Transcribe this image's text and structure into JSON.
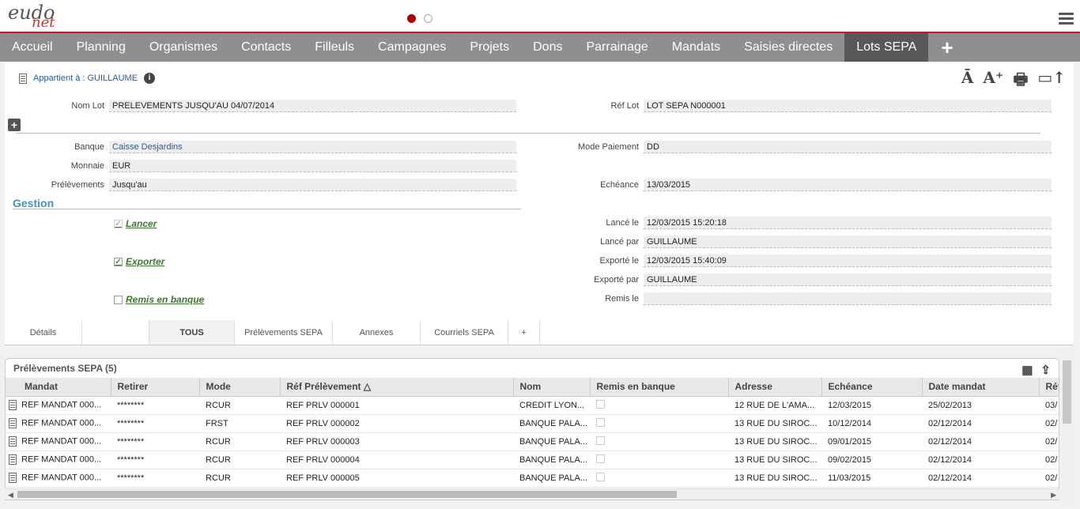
{
  "header": {
    "logo_main": "eudo",
    "logo_sub": "net"
  },
  "nav": {
    "items": [
      "Accueil",
      "Planning",
      "Organismes",
      "Contacts",
      "Filleuls",
      "Campagnes",
      "Projets",
      "Dons",
      "Parrainage",
      "Mandats",
      "Saisies directes",
      "Lots SEPA"
    ],
    "active": "Lots SEPA",
    "add": "+"
  },
  "record": {
    "owner": "Appartient à : GUILLAUME",
    "tools": [
      "Ā",
      "A⁺",
      "🖶",
      "▭↑"
    ],
    "nom_lot_label": "Nom Lot",
    "nom_lot": "PRELEVEMENTS JUSQU'AU 04/07/2014",
    "ref_lot_label": "Réf Lot",
    "ref_lot": "LOT SEPA N000001",
    "banque_label": "Banque",
    "banque": "Caisse Desjardins",
    "monnaie_label": "Monnaie",
    "monnaie": "EUR",
    "prelevements_label": "Prélèvements",
    "prelevements": "Jusqu'au",
    "mode_paiement_label": "Mode Paiement",
    "mode_paiement": "DD",
    "echeance_label": "Echéance",
    "echeance": "13/03/2015",
    "gestion": "Gestion",
    "lancer": "Lancer",
    "exporter": "Exporter",
    "remis": "Remis en banque",
    "lance_le_label": "Lancé le",
    "lance_le": "12/03/2015 15:20:18",
    "lance_par_label": "Lancé par",
    "lance_par": "GUILLAUME",
    "exporte_le_label": "Exporté le",
    "exporte_le": "12/03/2015 15:40:09",
    "exporte_par_label": "Exporté par",
    "exporte_par": "GUILLAUME",
    "remis_le_label": "Remis le",
    "remis_le": ""
  },
  "tabs": [
    "Détails",
    "TOUS",
    "Prélèvements SEPA",
    "Annexes",
    "Courriels SEPA",
    "+"
  ],
  "grid": {
    "title": "Prélèvements SEPA (5)",
    "columns": [
      "Mandat",
      "Retirer",
      "Mode",
      "Réf Prélèvement △",
      "Nom",
      "Remis en banque",
      "Adresse",
      "Echéance",
      "Date mandat",
      "Réf"
    ],
    "rows": [
      [
        "REF MANDAT 000...",
        "********",
        "RCUR",
        "REF PRLV 000001",
        "CREDIT LYON...",
        "",
        "12 RUE DE L'AMA...",
        "12/03/2015",
        "25/02/2013",
        "03/"
      ],
      [
        "REF MANDAT 000...",
        "********",
        "FRST",
        "REF PRLV 000002",
        "BANQUE PALA...",
        "",
        "13 RUE DU SIROC...",
        "10/12/2014",
        "02/12/2014",
        "02/"
      ],
      [
        "REF MANDAT 000...",
        "********",
        "RCUR",
        "REF PRLV 000003",
        "BANQUE PALA...",
        "",
        "13 RUE DU SIROC...",
        "09/01/2015",
        "02/12/2014",
        "02/"
      ],
      [
        "REF MANDAT 000...",
        "********",
        "RCUR",
        "REF PRLV 000004",
        "BANQUE PALA...",
        "",
        "13 RUE DU SIROC...",
        "09/02/2015",
        "02/12/2014",
        "02/"
      ],
      [
        "REF MANDAT 000...",
        "********",
        "RCUR",
        "REF PRLV 000005",
        "BANQUE PALA...",
        "",
        "13 RUE DU SIROC...",
        "11/03/2015",
        "02/12/2014",
        "02/"
      ]
    ]
  },
  "colors": {
    "accent": "#b52025",
    "nav_bg": "#8f8f8f",
    "nav_active": "#585858",
    "link": "#2a5a9a",
    "gestion": "#4a90b8",
    "check_green": "#3a7a2a"
  }
}
